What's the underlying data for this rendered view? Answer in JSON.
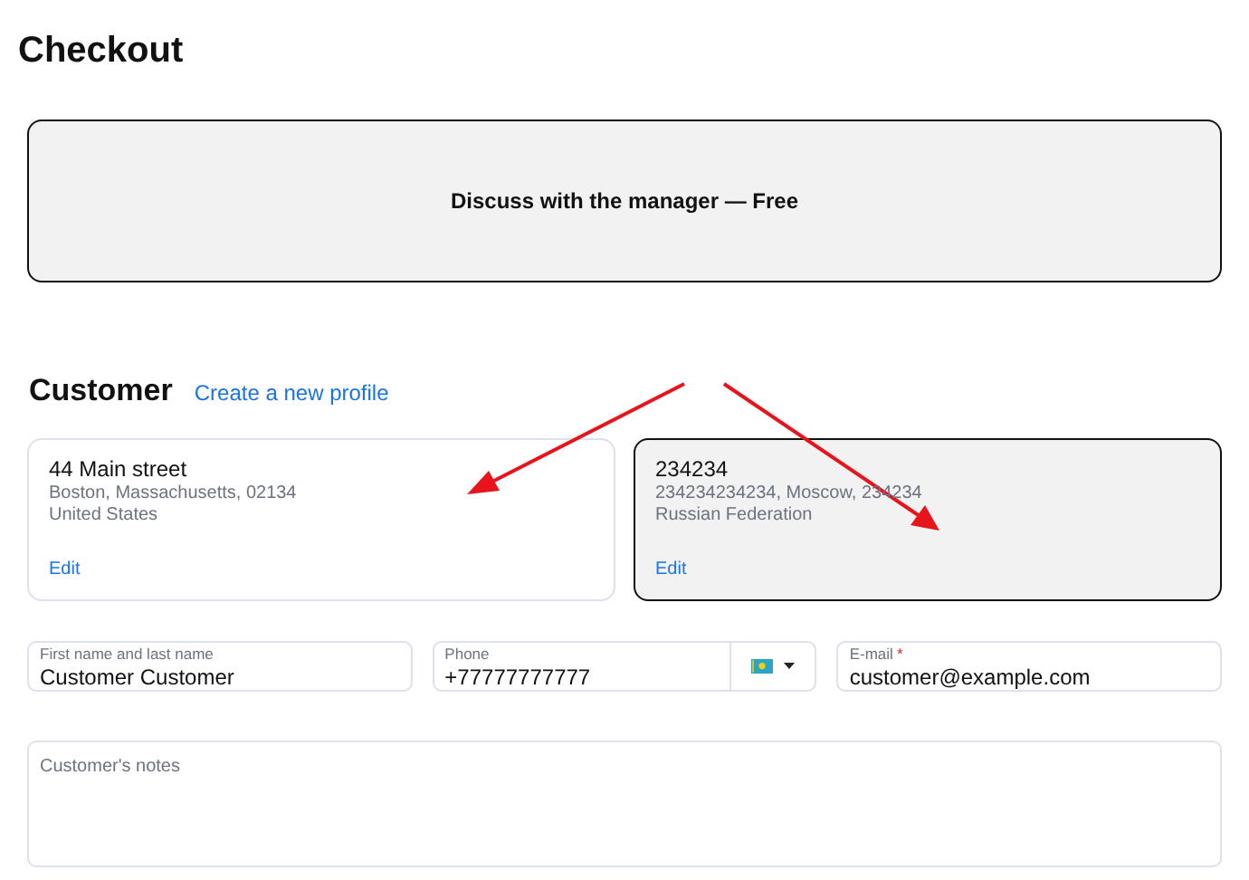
{
  "page_title": "Checkout",
  "manager_option": {
    "label": "Discuss with the manager — Free"
  },
  "customer": {
    "heading": "Customer",
    "create_link": "Create a new profile"
  },
  "profiles": [
    {
      "title": "44 Main street",
      "line_1": "Boston, Massachusetts, 02134",
      "line_2": "United States",
      "edit": "Edit",
      "selected": false
    },
    {
      "title": "234234",
      "line_1": "234234234234, Moscow, 234234",
      "line_2": "Russian Federation",
      "edit": "Edit",
      "selected": true
    }
  ],
  "fields": [
    {
      "kind": "text",
      "label": "First name and last name",
      "value": "Customer Customer"
    },
    {
      "kind": "phone",
      "label": "Phone",
      "value": "+77777777777"
    },
    {
      "kind": "text",
      "label": "E-mail",
      "value": "customer@example.com",
      "required_mark": "*"
    }
  ],
  "notes": {
    "placeholder": "Customer's notes"
  }
}
